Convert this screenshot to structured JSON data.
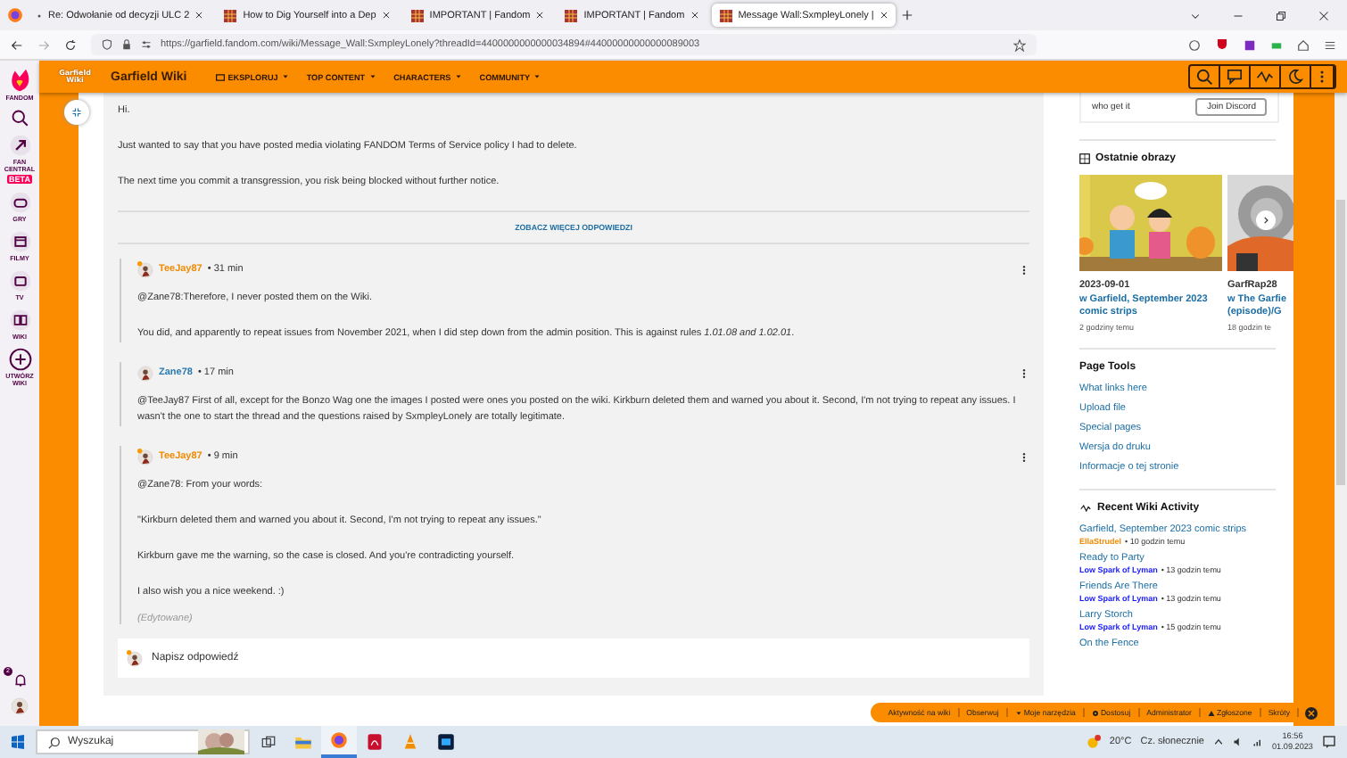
{
  "browser": {
    "tabs": [
      {
        "title": "Re: Odwołanie od decyzji ULC 2",
        "selected": false
      },
      {
        "title": "How to Dig Yourself into a Dep",
        "selected": false
      },
      {
        "title": "IMPORTANT | Fandom",
        "selected": false
      },
      {
        "title": "IMPORTANT | Fandom",
        "selected": false
      },
      {
        "title": "Message Wall:SxmpleyLonely | ",
        "selected": true
      }
    ],
    "url": "https://garfield.fandom.com/wiki/Message_Wall:SxmpleyLonely?threadId=4400000000000034894#44000000000000089003"
  },
  "fandom_rail": {
    "logo": "FANDOM",
    "items": [
      {
        "label": "FAN CENTRAL",
        "badge": "BETA"
      },
      {
        "label": "GRY"
      },
      {
        "label": "FILMY"
      },
      {
        "label": "TV"
      },
      {
        "label": "WIKI"
      },
      {
        "label": "UTWÓRZ WIKI"
      }
    ],
    "notifications": "2"
  },
  "wiki_header": {
    "logo": "Garfield Wiki",
    "title": "Garfield Wiki",
    "nav": [
      "EKSPLORUJ",
      "TOP CONTENT",
      "CHARACTERS",
      "COMMUNITY"
    ]
  },
  "thread": {
    "paragraphs": [
      "Hi.",
      "Just wanted to say that you have posted media violating FANDOM Terms of Service policy I had to delete.",
      "The next time you commit a transgression, you risk being blocked without further notice."
    ],
    "more_replies": "ZOBACZ WIĘCEJ ODPOWIEDZI",
    "replies": [
      {
        "author": "TeeJay87",
        "color": "#f08a00",
        "badge": true,
        "time": "• 31 min",
        "paragraphs": [
          "@Zane78:Therefore, I never posted them on the Wiki.",
          "You did, and apparently to repeat issues from November 2021, when I did step down from the admin position. This is against rules *1.01.08 and 1.02.01*."
        ]
      },
      {
        "author": "Zane78",
        "color": "#2a7ab0",
        "badge": false,
        "time": "• 17 min",
        "paragraphs": [
          "@TeeJay87 First of all, except for the Bonzo Wag one the images I posted were ones you posted on the wiki. Kirkburn deleted them and warned you about it. Second, I'm not trying to repeat any issues. I wasn't the one to start the thread and the questions raised by SxmpleyLonely are totally legitimate."
        ]
      },
      {
        "author": "TeeJay87",
        "color": "#f08a00",
        "badge": true,
        "time": "• 9 min",
        "paragraphs": [
          "@Zane78: From your words:",
          "\"Kirkburn deleted them and warned you about it. Second, I'm not trying to repeat any issues.\"",
          "Kirkburn gave me the warning, so the case is closed. And you're contradicting yourself.",
          "I also wish you a nice weekend. :)"
        ],
        "edited": "(Edytowane)"
      }
    ],
    "reply_placeholder": "Napisz odpowiedź"
  },
  "sidebar": {
    "discord": {
      "text": "who get it",
      "button": "Join Discord"
    },
    "recent_images": {
      "title": "Ostatnie obrazy",
      "items": [
        {
          "title": "2023-09-01",
          "link": "w Garfield, September 2023 comic strips",
          "time": "2 godziny temu"
        },
        {
          "title": "GarfRap28",
          "link": "w The Garfie (episode)/G",
          "time": "18 godzin te"
        }
      ]
    },
    "page_tools": {
      "title": "Page Tools",
      "links": [
        "What links here",
        "Upload file",
        "Special pages",
        "Wersja do druku",
        "Informacje o tej stronie"
      ]
    },
    "activity": {
      "title": "Recent Wiki Activity",
      "items": [
        {
          "title": "Garfield, September 2023 comic strips",
          "user": "EllaStrudel",
          "color": "#f08a00",
          "time": "• 10 godzin temu"
        },
        {
          "title": "Ready to Party",
          "user": "Low Spark of Lyman",
          "color": "#1a1aff",
          "time": "• 13 godzin temu"
        },
        {
          "title": "Friends Are There",
          "user": "Low Spark of Lyman",
          "color": "#1a1aff",
          "time": "• 13 godzin temu"
        },
        {
          "title": "Larry Storch",
          "user": "Low Spark of Lyman",
          "color": "#1a1aff",
          "time": "• 15 godzin temu"
        },
        {
          "title": "On the Fence"
        }
      ]
    }
  },
  "toolbar": [
    "Aktywność na wiki",
    "Obserwuj",
    "Moje narzędzia",
    "Dostosuj",
    "Administrator",
    "Zgłoszone",
    "Skróty"
  ],
  "taskbar": {
    "search_placeholder": "Wyszukaj",
    "apps": [
      {
        "kind": "taskview",
        "selected": false
      },
      {
        "kind": "folder",
        "selected": false
      },
      {
        "kind": "browser",
        "selected": true
      },
      {
        "kind": "pdf",
        "selected": false
      },
      {
        "kind": "cone",
        "selected": false
      },
      {
        "kind": "editor",
        "selected": false
      }
    ],
    "temperature": "20°C",
    "weather": "Cz. słonecznie",
    "time": "16:56",
    "date": "01.09.2023"
  }
}
